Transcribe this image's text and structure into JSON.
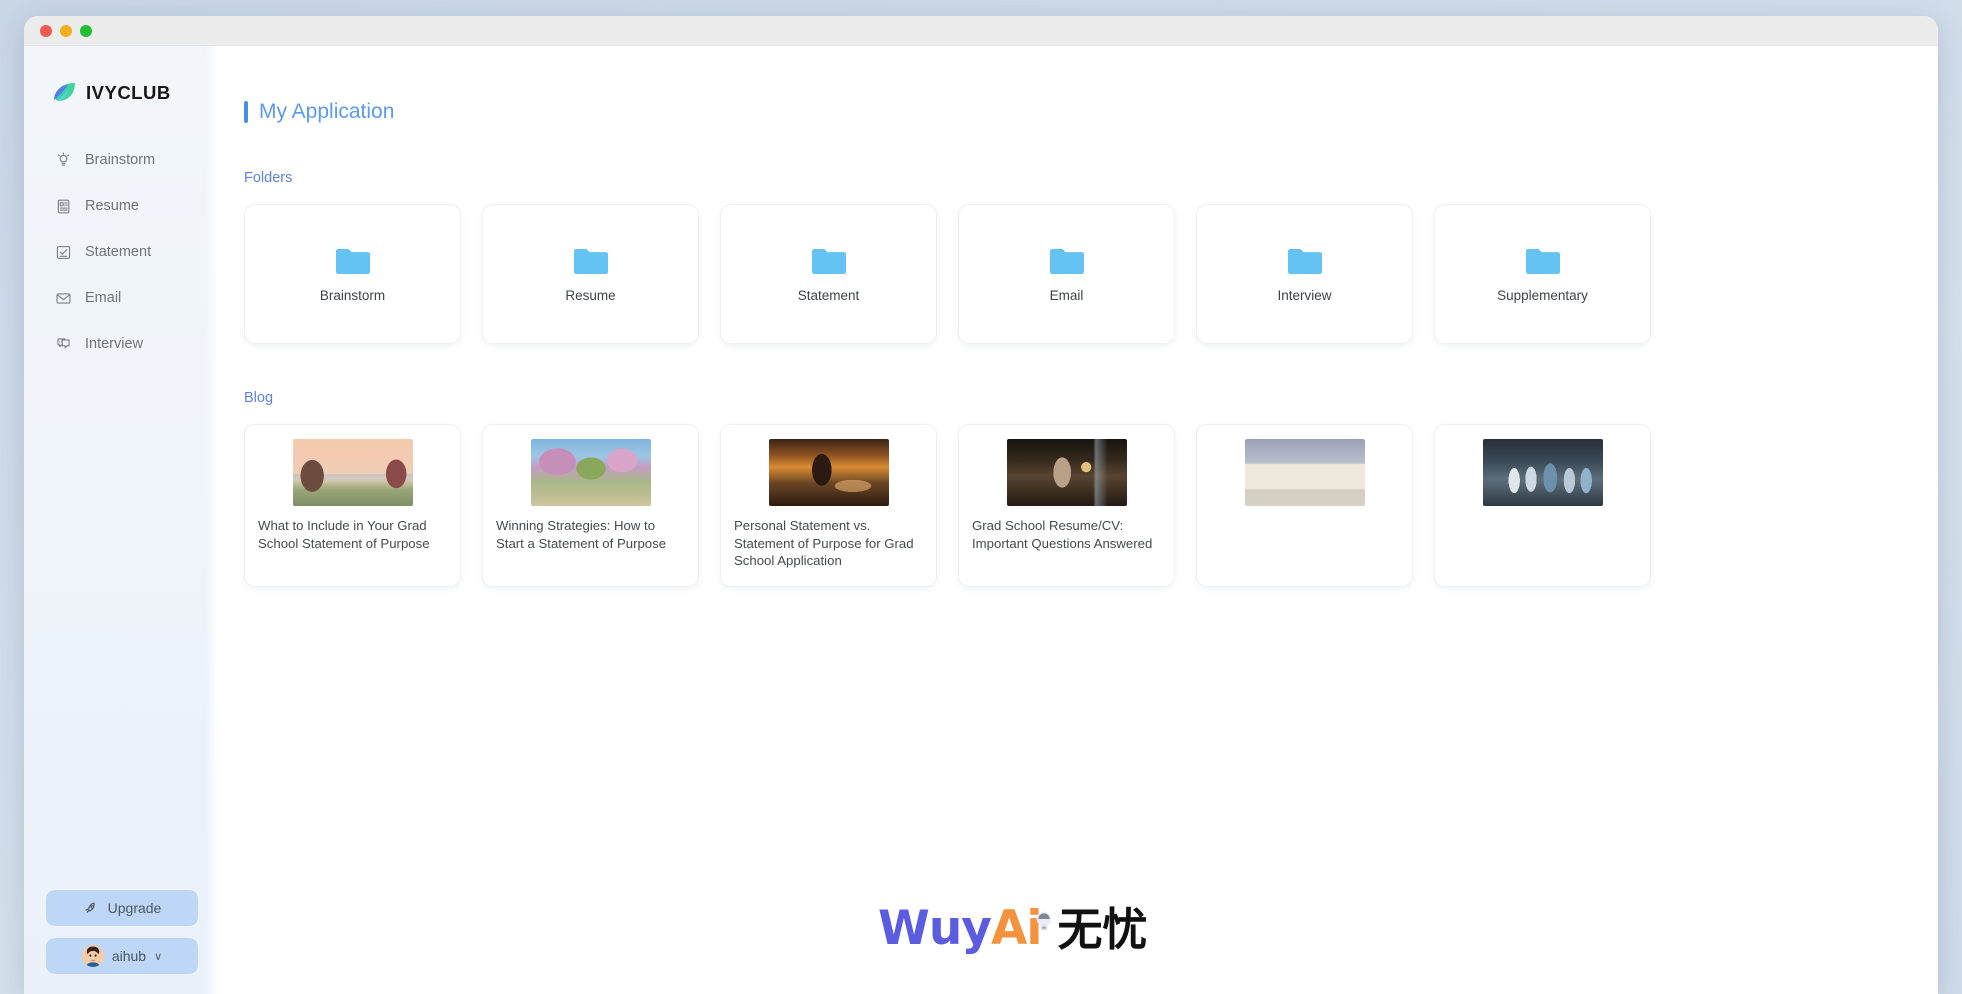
{
  "window": {
    "traffic_lights": [
      {
        "name": "close",
        "color": "#f05a52"
      },
      {
        "name": "minimize",
        "color": "#f2b01e"
      },
      {
        "name": "maximize",
        "color": "#22bf33"
      }
    ]
  },
  "sidebar": {
    "brand": {
      "name": "IVYCLUB",
      "icon": "leaf-logo-icon"
    },
    "items": [
      {
        "label": "Brainstorm",
        "icon": "lightbulb-icon"
      },
      {
        "label": "Resume",
        "icon": "document-icon"
      },
      {
        "label": "Statement",
        "icon": "checklist-icon"
      },
      {
        "label": "Email",
        "icon": "envelope-icon"
      },
      {
        "label": "Interview",
        "icon": "chat-bubbles-icon"
      }
    ],
    "upgrade": {
      "label": "Upgrade",
      "icon": "rocket-icon"
    },
    "account": {
      "label": "aihub",
      "chevron": "∨",
      "icon": "avatar"
    }
  },
  "main": {
    "page_title": "My Application",
    "sections": {
      "folders_label": "Folders",
      "blog_label": "Blog"
    },
    "folders": [
      {
        "name": "Brainstorm"
      },
      {
        "name": "Resume"
      },
      {
        "name": "Statement"
      },
      {
        "name": "Email"
      },
      {
        "name": "Interview"
      },
      {
        "name": "Supplementary"
      }
    ],
    "blog_posts": [
      {
        "title": "What to Include in Your Grad School Statement of Purpose",
        "scene": "sc-park"
      },
      {
        "title": "Winning Strategies: How to Start a Statement of Purpose",
        "scene": "sc-blossom"
      },
      {
        "title": "Personal Statement vs. Statement of Purpose for Grad School Application",
        "scene": "sc-surf"
      },
      {
        "title": "Grad School Resume/CV: Important Questions Answered",
        "scene": "sc-study"
      },
      {
        "title": "",
        "scene": "sc-court"
      },
      {
        "title": "",
        "scene": "sc-doctors"
      }
    ]
  },
  "watermark": {
    "latin_primary": "Wuy",
    "latin_accent": "Ai",
    "chinese": "无忧",
    "color_primary": "#5c5ce0",
    "color_accent": "#f5923e"
  },
  "colors": {
    "accent_blue": "#5b9bea",
    "section_label": "#5b82e0",
    "folder_icon": "#64c3f2",
    "sidebar_bg": "#eff4fa",
    "pill_bg": "#bfd7f6"
  }
}
